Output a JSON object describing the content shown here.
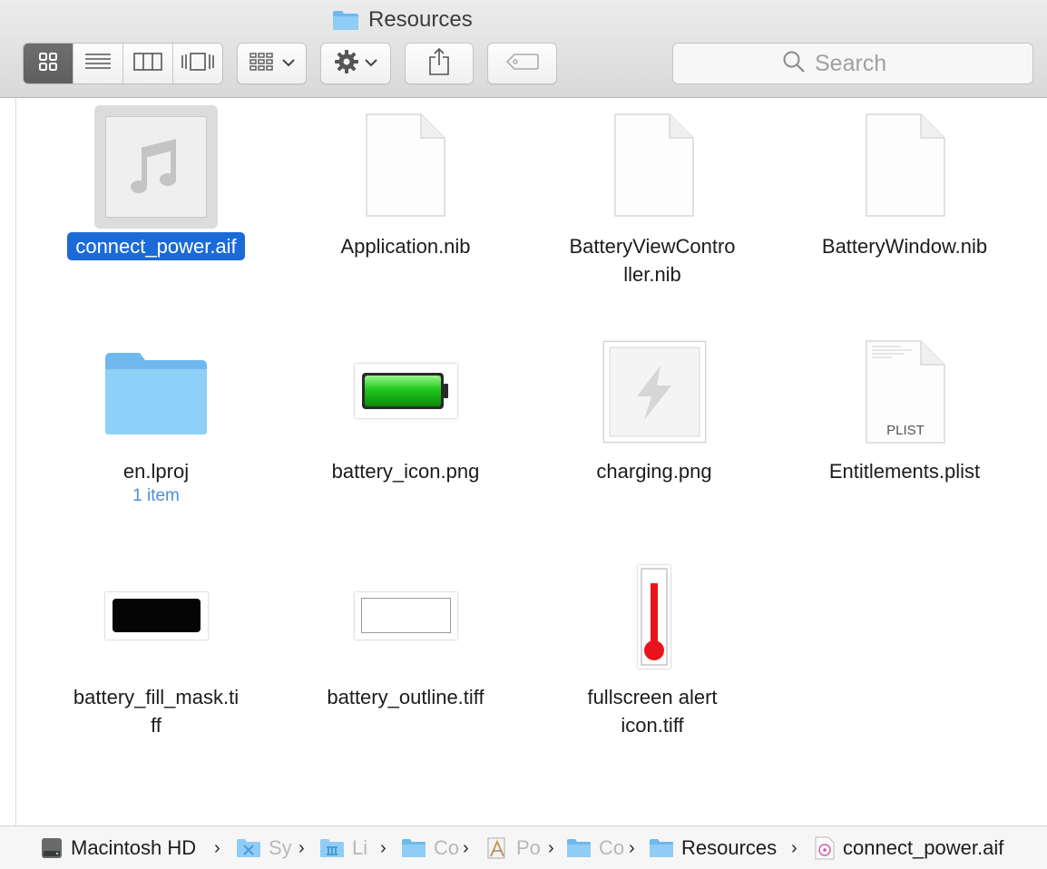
{
  "window": {
    "title": "Resources"
  },
  "toolbar": {
    "view_buttons": [
      {
        "icon": "icon-view-icon",
        "active": true
      },
      {
        "icon": "list-view-icon",
        "active": false
      },
      {
        "icon": "column-view-icon",
        "active": false
      },
      {
        "icon": "cover-flow-view-icon",
        "active": false
      }
    ],
    "arrange_icon": "arrange-grid-icon",
    "action_icon": "gear-icon",
    "share_icon": "share-icon",
    "tags_icon": "tag-icon",
    "search_placeholder": "Search"
  },
  "files": [
    {
      "name": "connect_power.aif",
      "icon": "audio-file-icon",
      "selected": true
    },
    {
      "name": "Application.nib",
      "icon": "document-icon"
    },
    {
      "name_line1": "BatteryViewContro",
      "name_line2": "ller.nib",
      "icon": "document-icon"
    },
    {
      "name": "BatteryWindow.nib",
      "icon": "document-icon"
    },
    {
      "name": "en.lproj",
      "sub": "1 item",
      "icon": "folder-icon"
    },
    {
      "name": "battery_icon.png",
      "icon": "battery-image-icon"
    },
    {
      "name": "charging.png",
      "icon": "charging-image-icon"
    },
    {
      "name": "Entitlements.plist",
      "icon": "plist-icon",
      "badge": "PLIST"
    },
    {
      "name_line1": "battery_fill_mask.ti",
      "name_line2": "ff",
      "icon": "black-rectangle-image-icon"
    },
    {
      "name": "battery_outline.tiff",
      "icon": "white-rectangle-image-icon"
    },
    {
      "name_line1": "fullscreen alert",
      "name_line2": "icon.tiff",
      "icon": "thermometer-image-icon"
    }
  ],
  "path_bar": {
    "items": [
      {
        "label": "Macintosh HD",
        "icon": "hard-drive-icon"
      },
      {
        "label": "Sy",
        "icon": "system-folder-icon"
      },
      {
        "label": "Li",
        "icon": "library-folder-icon"
      },
      {
        "label": "Co",
        "icon": "folder-icon"
      },
      {
        "label": "Po",
        "icon": "app-icon"
      },
      {
        "label": "Co",
        "icon": "folder-icon"
      },
      {
        "label": "Resources",
        "icon": "folder-icon"
      },
      {
        "label": "connect_power.aif",
        "icon": "audio-file-icon"
      }
    ],
    "separator": "›"
  },
  "colors": {
    "selection": "#1b6ad8",
    "folder": "#7cc4f4",
    "battery_green": "#22c81c",
    "thermometer_red": "#e8141c",
    "subtitle_blue": "#4d8fd6"
  }
}
